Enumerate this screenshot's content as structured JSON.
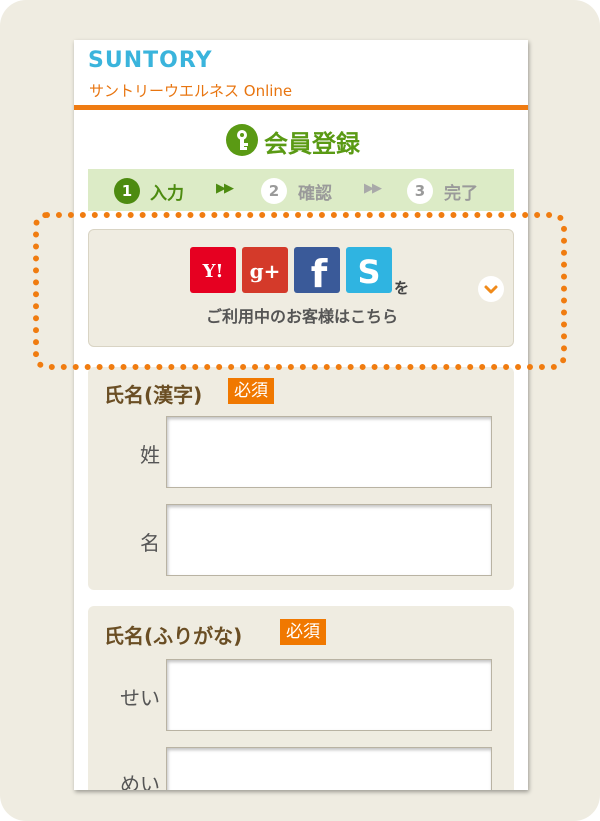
{
  "header": {
    "logo": "SUNTORY",
    "subtitle": "サントリーウエルネス Online"
  },
  "page": {
    "title": "会員登録"
  },
  "steps": [
    {
      "number": "1",
      "label": "入力"
    },
    {
      "number": "2",
      "label": "確認"
    },
    {
      "number": "3",
      "label": "完了"
    }
  ],
  "step_arrow": "▶▶",
  "social": {
    "icons": [
      "yahoo-icon",
      "google-plus-icon",
      "facebook-icon",
      "s-icon"
    ],
    "yahoo_text": "Y!",
    "google_text": "g+",
    "facebook_text": "f",
    "s_text": "S",
    "wo": "を",
    "text": "ご利用中のお客様はこちら"
  },
  "name_kanji": {
    "label": "氏名(漢字)",
    "badge": "必須",
    "last_label": "姓",
    "first_label": "名",
    "last_value": "",
    "first_value": ""
  },
  "name_kana": {
    "label": "氏名(ふりがな)",
    "badge": "必須",
    "last_label": "せい",
    "first_label": "めい",
    "last_value": "",
    "first_value": ""
  },
  "colors": {
    "accent": "#f07c10",
    "brand_blue": "#3ab4dc",
    "green": "#5a9a14",
    "step_bg": "#dcebc6"
  }
}
